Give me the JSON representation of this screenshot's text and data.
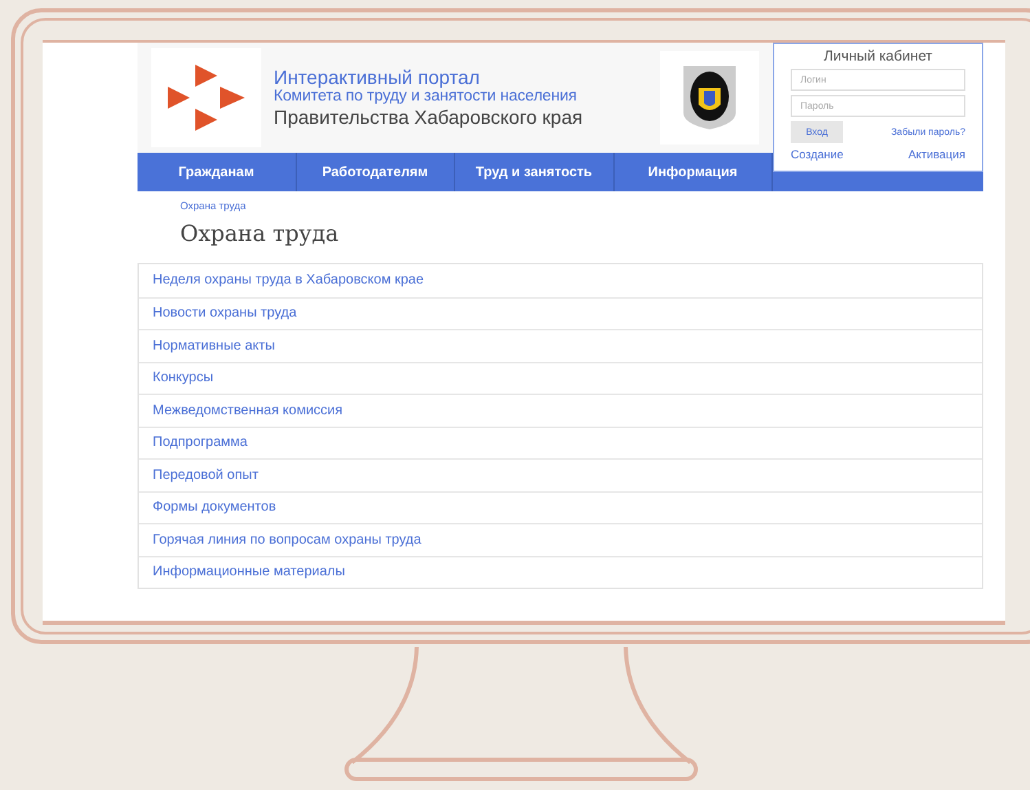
{
  "header": {
    "title": "Интерактивный портал",
    "subtitle": "Комитета по труду и занятости населения",
    "caption": "Правительства Хабаровского края"
  },
  "login": {
    "title": "Личный кабинет",
    "login_placeholder": "Логин",
    "password_placeholder": "Пароль",
    "submit": "Вход",
    "forgot": "Забыли пароль?",
    "create": "Создание",
    "activate": "Активация"
  },
  "nav": [
    "Гражданам",
    "Работодателям",
    "Труд и занятость",
    "Информация"
  ],
  "breadcrumb": "Охрана труда",
  "heading": "Охрана труда",
  "items": [
    "Неделя охраны труда в Хабаровском крае",
    "Новости охраны труда",
    "Нормативные акты",
    "Конкурсы",
    "Межведомственная комиссия",
    "Подпрограмма",
    "Передовой опыт",
    "Формы документов",
    "Горячая линия по вопросам охраны труда",
    "Информационные материалы"
  ]
}
